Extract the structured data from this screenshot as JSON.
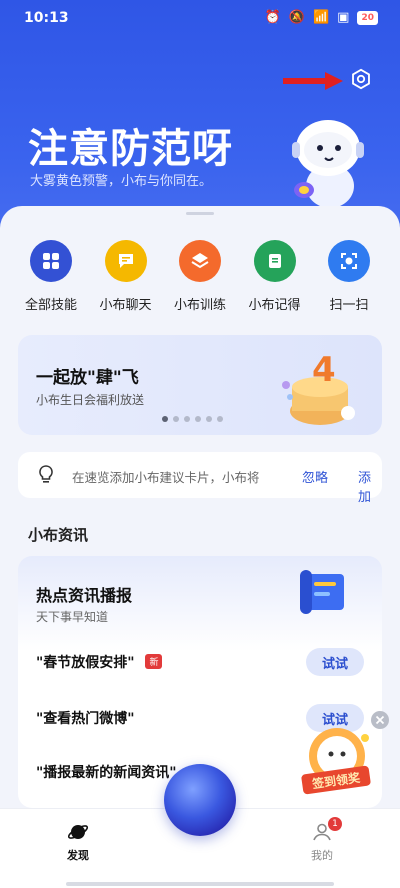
{
  "status_bar": {
    "time": "10:13",
    "battery": "20"
  },
  "hero": {
    "title": "注意防范呀",
    "subtitle": "大雾黄色预警，小布与你同在。"
  },
  "skills": [
    {
      "label": "全部技能",
      "icon": "grid-icon",
      "color": "#3351d4"
    },
    {
      "label": "小布聊天",
      "icon": "chat-icon",
      "color": "#f5b800"
    },
    {
      "label": "小布训练",
      "icon": "layers-icon",
      "color": "#f46a2c"
    },
    {
      "label": "小布记得",
      "icon": "note-icon",
      "color": "#25a35a"
    },
    {
      "label": "扫一扫",
      "icon": "scan-icon",
      "color": "#2f7bf0"
    }
  ],
  "banner": {
    "title": "一起放\"肆\"飞",
    "subtitle": "小布生日会福利放送",
    "page_count": 6,
    "active_page": 1
  },
  "suggestion": {
    "text": "在速览添加小布建议卡片，小布将",
    "ignore": "忽略",
    "add": "添加"
  },
  "news_section": {
    "title": "小布资讯",
    "card_title": "热点资讯播报",
    "card_subtitle": "天下事早知道",
    "items": [
      {
        "text": "\"春节放假安排\"",
        "badge": "新",
        "action": "试试"
      },
      {
        "text": "\"查看热门微博\"",
        "action": "试试"
      },
      {
        "text": "\"播报最新的新闻资讯\""
      }
    ]
  },
  "floating": {
    "sign_label": "签到领奖"
  },
  "bottom_nav": {
    "discover": "发现",
    "mine": "我的",
    "mine_badge": "1"
  },
  "colors": {
    "hero": "#3a63ee",
    "accent": "#3155d6",
    "badge": "#e23a3a"
  }
}
